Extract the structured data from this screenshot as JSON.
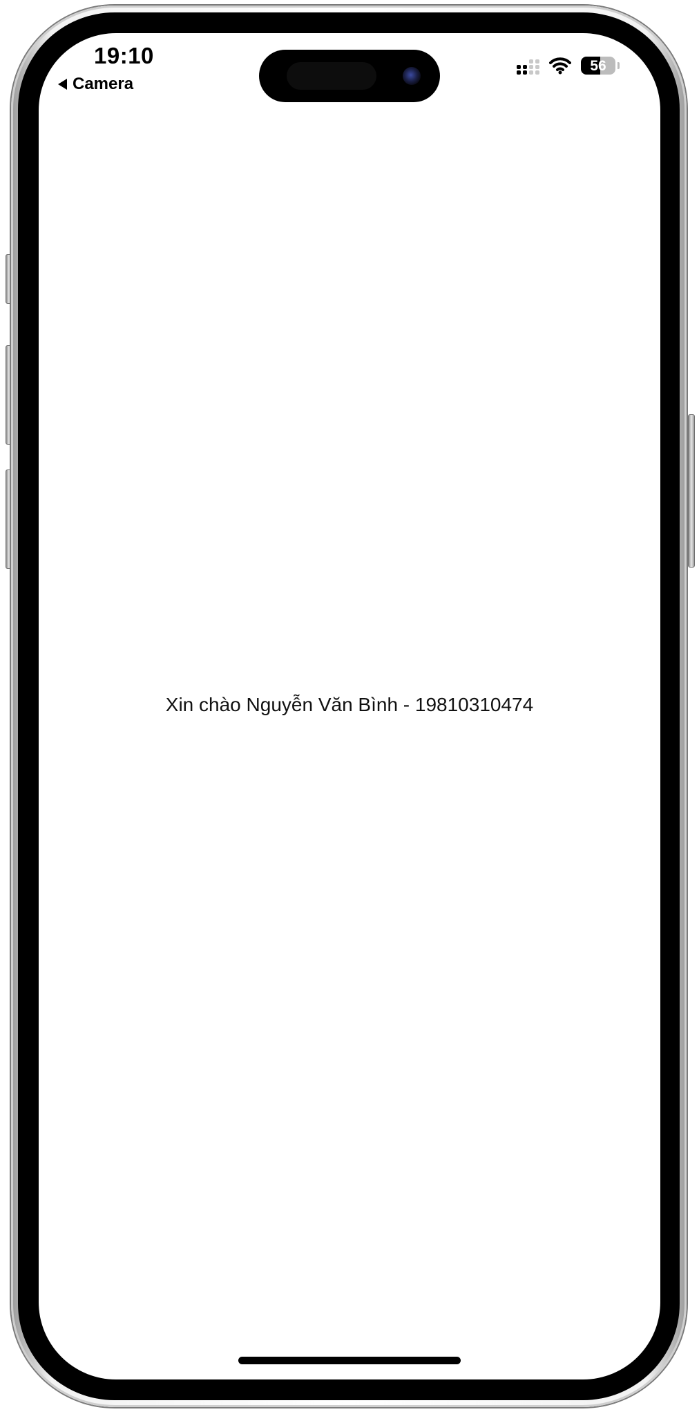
{
  "status_bar": {
    "time": "19:10",
    "back_app_label": "Camera",
    "battery_level": "56",
    "icons": [
      "signal-icon",
      "wifi-icon",
      "battery-icon"
    ]
  },
  "main": {
    "greeting": "Xin chào Nguyễn Văn Bình - 19810310474"
  },
  "colors": {
    "background": "#ffffff",
    "text": "#111111",
    "frame": "#000000"
  }
}
